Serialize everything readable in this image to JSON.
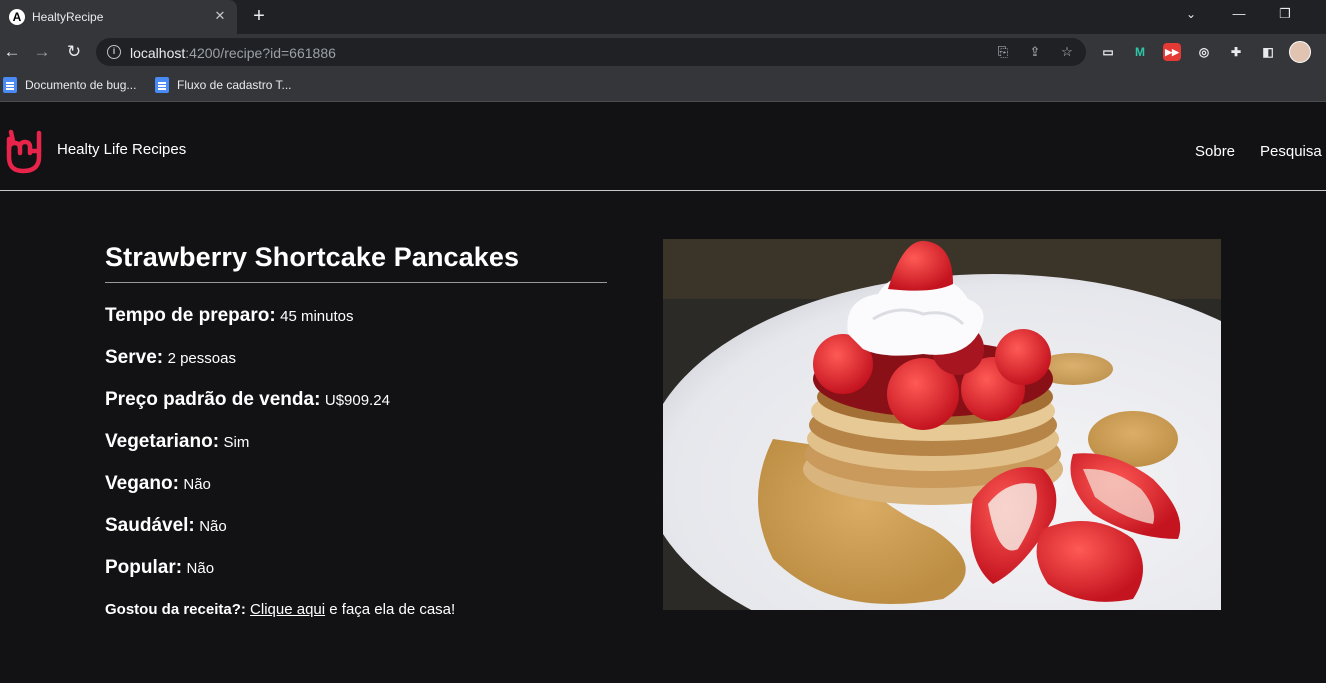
{
  "browser": {
    "tab_title": "HealtyRecipe",
    "tab_favicon": "A",
    "url_host": "localhost",
    "url_rest": ":4200/recipe?id=661886",
    "bookmarks": [
      {
        "label": "Documento de bug..."
      },
      {
        "label": "Fluxo de cadastro T..."
      }
    ]
  },
  "header": {
    "brand": "Healty Life Recipes",
    "nav": [
      {
        "label": "Sobre"
      },
      {
        "label": "Pesquisa"
      }
    ]
  },
  "recipe": {
    "title": "Strawberry Shortcake Pancakes",
    "fields": [
      {
        "label": "Tempo de preparo:",
        "value": "45 minutos"
      },
      {
        "label": "Serve:",
        "value": "2 pessoas"
      },
      {
        "label": "Preço padrão de venda:",
        "value": "U$909.24"
      },
      {
        "label": "Vegetariano:",
        "value": "Sim"
      },
      {
        "label": "Vegano:",
        "value": "Não"
      },
      {
        "label": "Saudável:",
        "value": "Não"
      },
      {
        "label": "Popular:",
        "value": "Não"
      }
    ],
    "cta": {
      "label": "Gostou da receita?:",
      "link": "Clique aqui",
      "suffix": "e faça ela de casa!"
    }
  },
  "colors": {
    "brand_accent": "#e8244a",
    "page_background": "#121214"
  }
}
